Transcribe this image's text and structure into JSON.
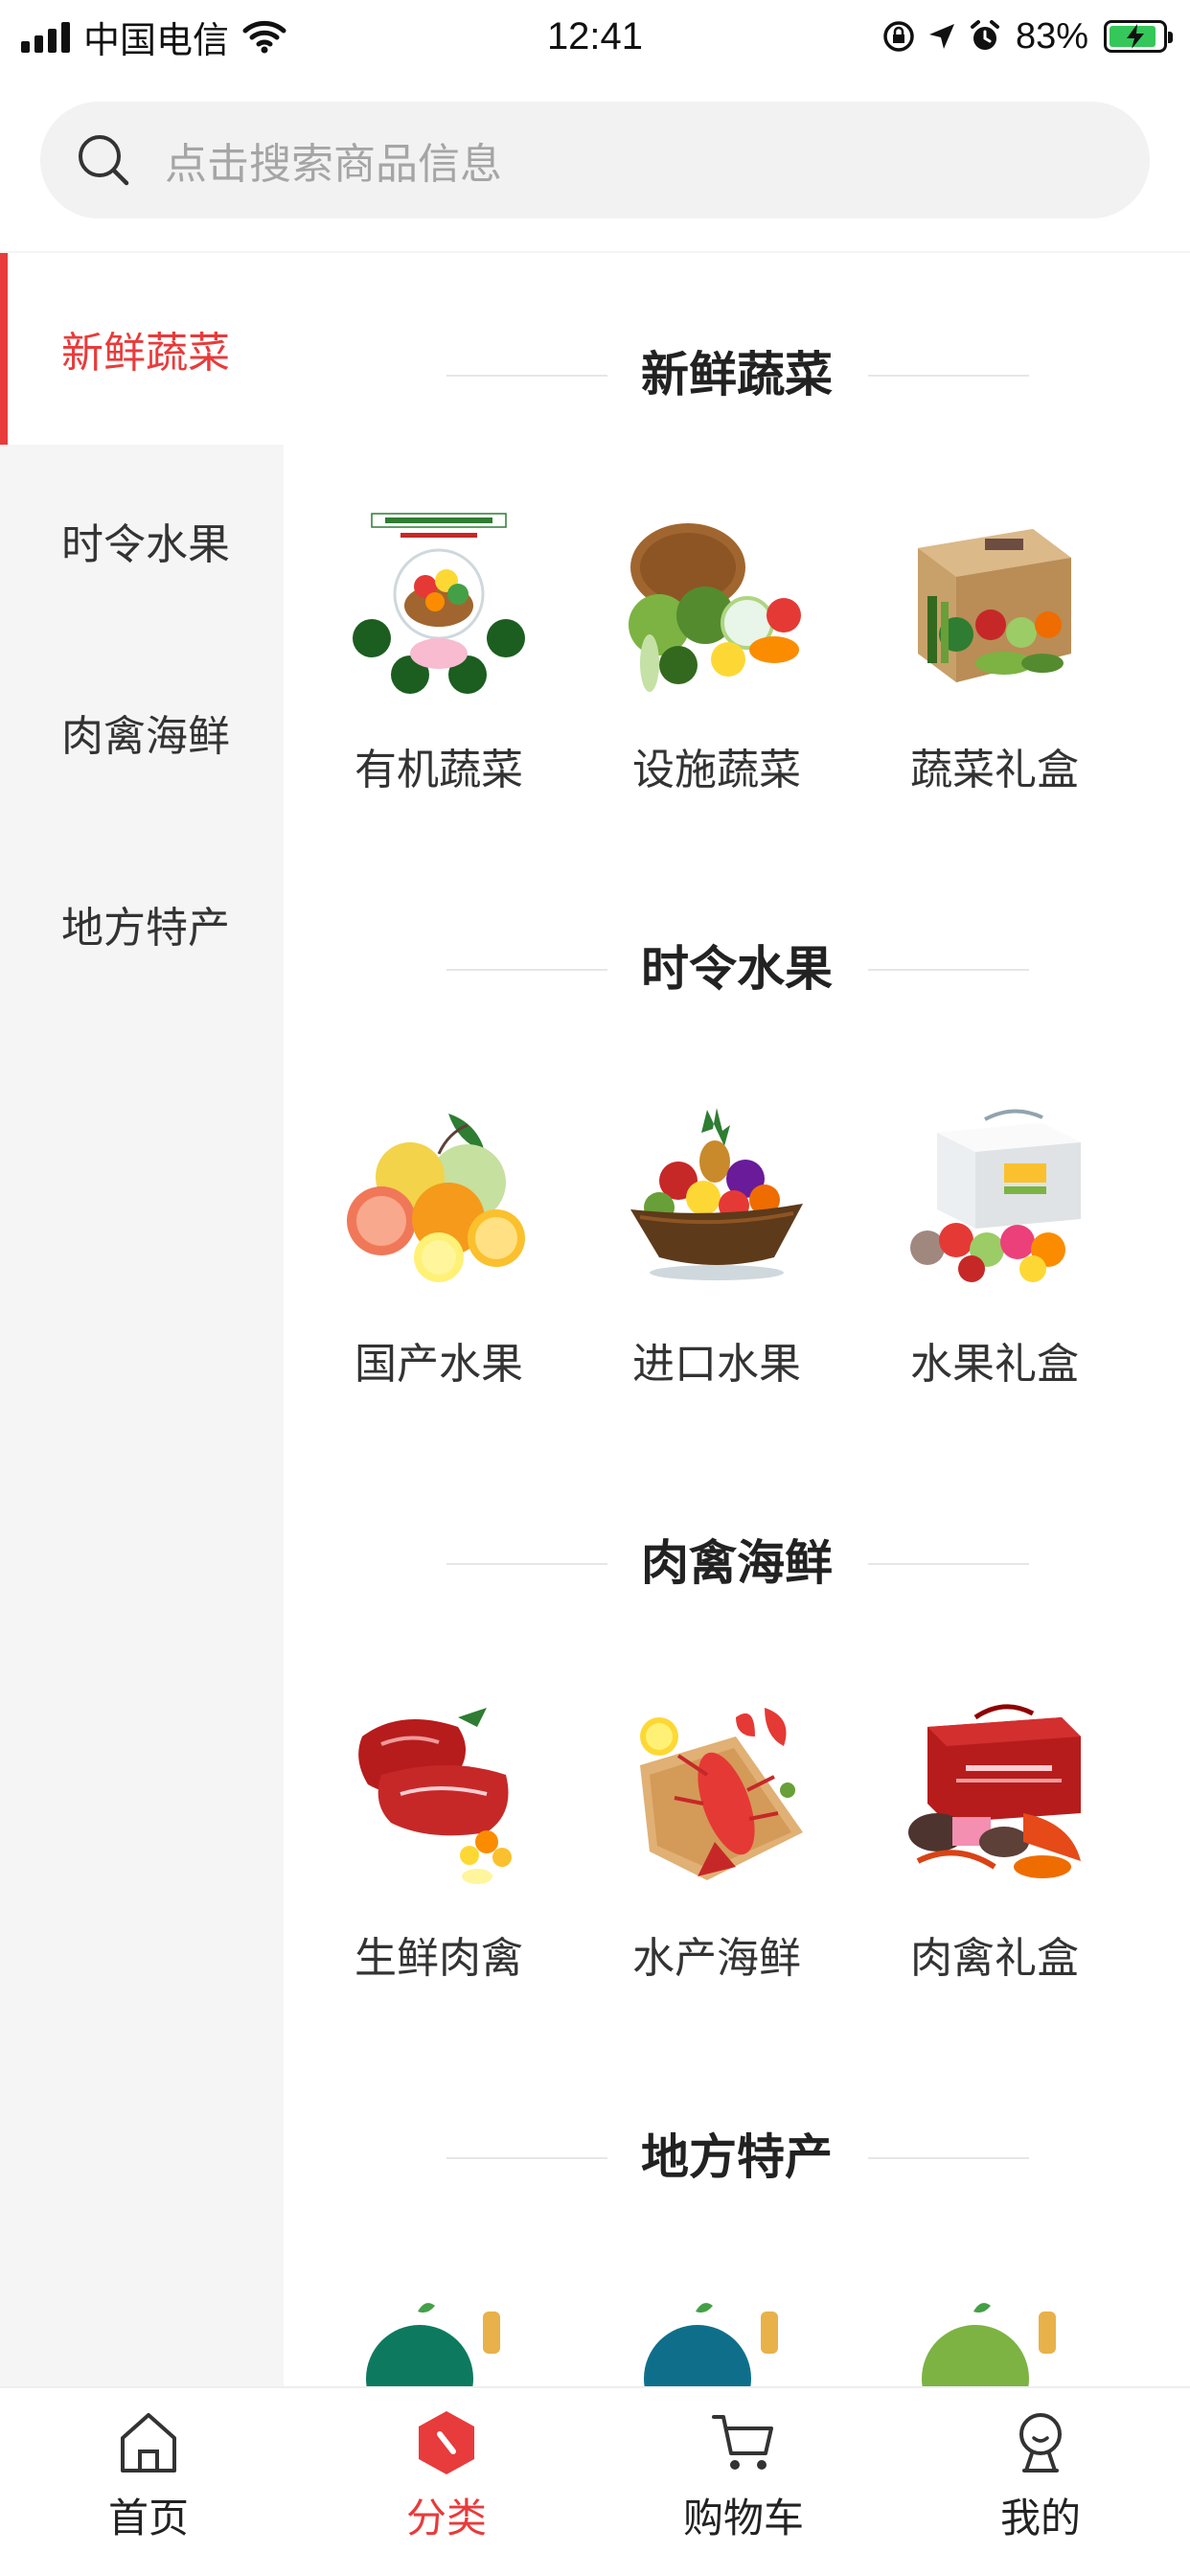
{
  "status_bar": {
    "carrier": "中国电信",
    "time": "12:41",
    "battery": "83%"
  },
  "search": {
    "placeholder": "点击搜索商品信息"
  },
  "sidebar": {
    "items": [
      {
        "label": "新鲜蔬菜",
        "active": true
      },
      {
        "label": "时令水果",
        "active": false
      },
      {
        "label": "肉禽海鲜",
        "active": false
      },
      {
        "label": "地方特产",
        "active": false
      }
    ]
  },
  "sections": [
    {
      "title": "新鲜蔬菜",
      "items": [
        {
          "label": "有机蔬菜",
          "icon": "organic-vegetables-image"
        },
        {
          "label": "设施蔬菜",
          "icon": "vegetable-basket-image"
        },
        {
          "label": "蔬菜礼盒",
          "icon": "vegetable-gift-box-image"
        }
      ]
    },
    {
      "title": "时令水果",
      "items": [
        {
          "label": "国产水果",
          "icon": "citrus-fruits-image"
        },
        {
          "label": "进口水果",
          "icon": "fruit-boat-image"
        },
        {
          "label": "水果礼盒",
          "icon": "fruit-gift-box-image"
        }
      ]
    },
    {
      "title": "肉禽海鲜",
      "items": [
        {
          "label": "生鲜肉禽",
          "icon": "raw-meat-image"
        },
        {
          "label": "水产海鲜",
          "icon": "lobster-image"
        },
        {
          "label": "肉禽礼盒",
          "icon": "seafood-gift-box-image"
        }
      ]
    },
    {
      "title": "地方特产",
      "items": []
    }
  ],
  "tab_bar": {
    "tabs": [
      {
        "label": "首页",
        "icon": "home-icon",
        "active": false
      },
      {
        "label": "分类",
        "icon": "category-icon",
        "active": true
      },
      {
        "label": "购物车",
        "icon": "cart-icon",
        "active": false
      },
      {
        "label": "我的",
        "icon": "profile-icon",
        "active": false
      }
    ]
  },
  "colors": {
    "accent": "#e83b3b",
    "sidebar_bg": "#f5f5f5",
    "search_bg": "#f2f2f2"
  }
}
